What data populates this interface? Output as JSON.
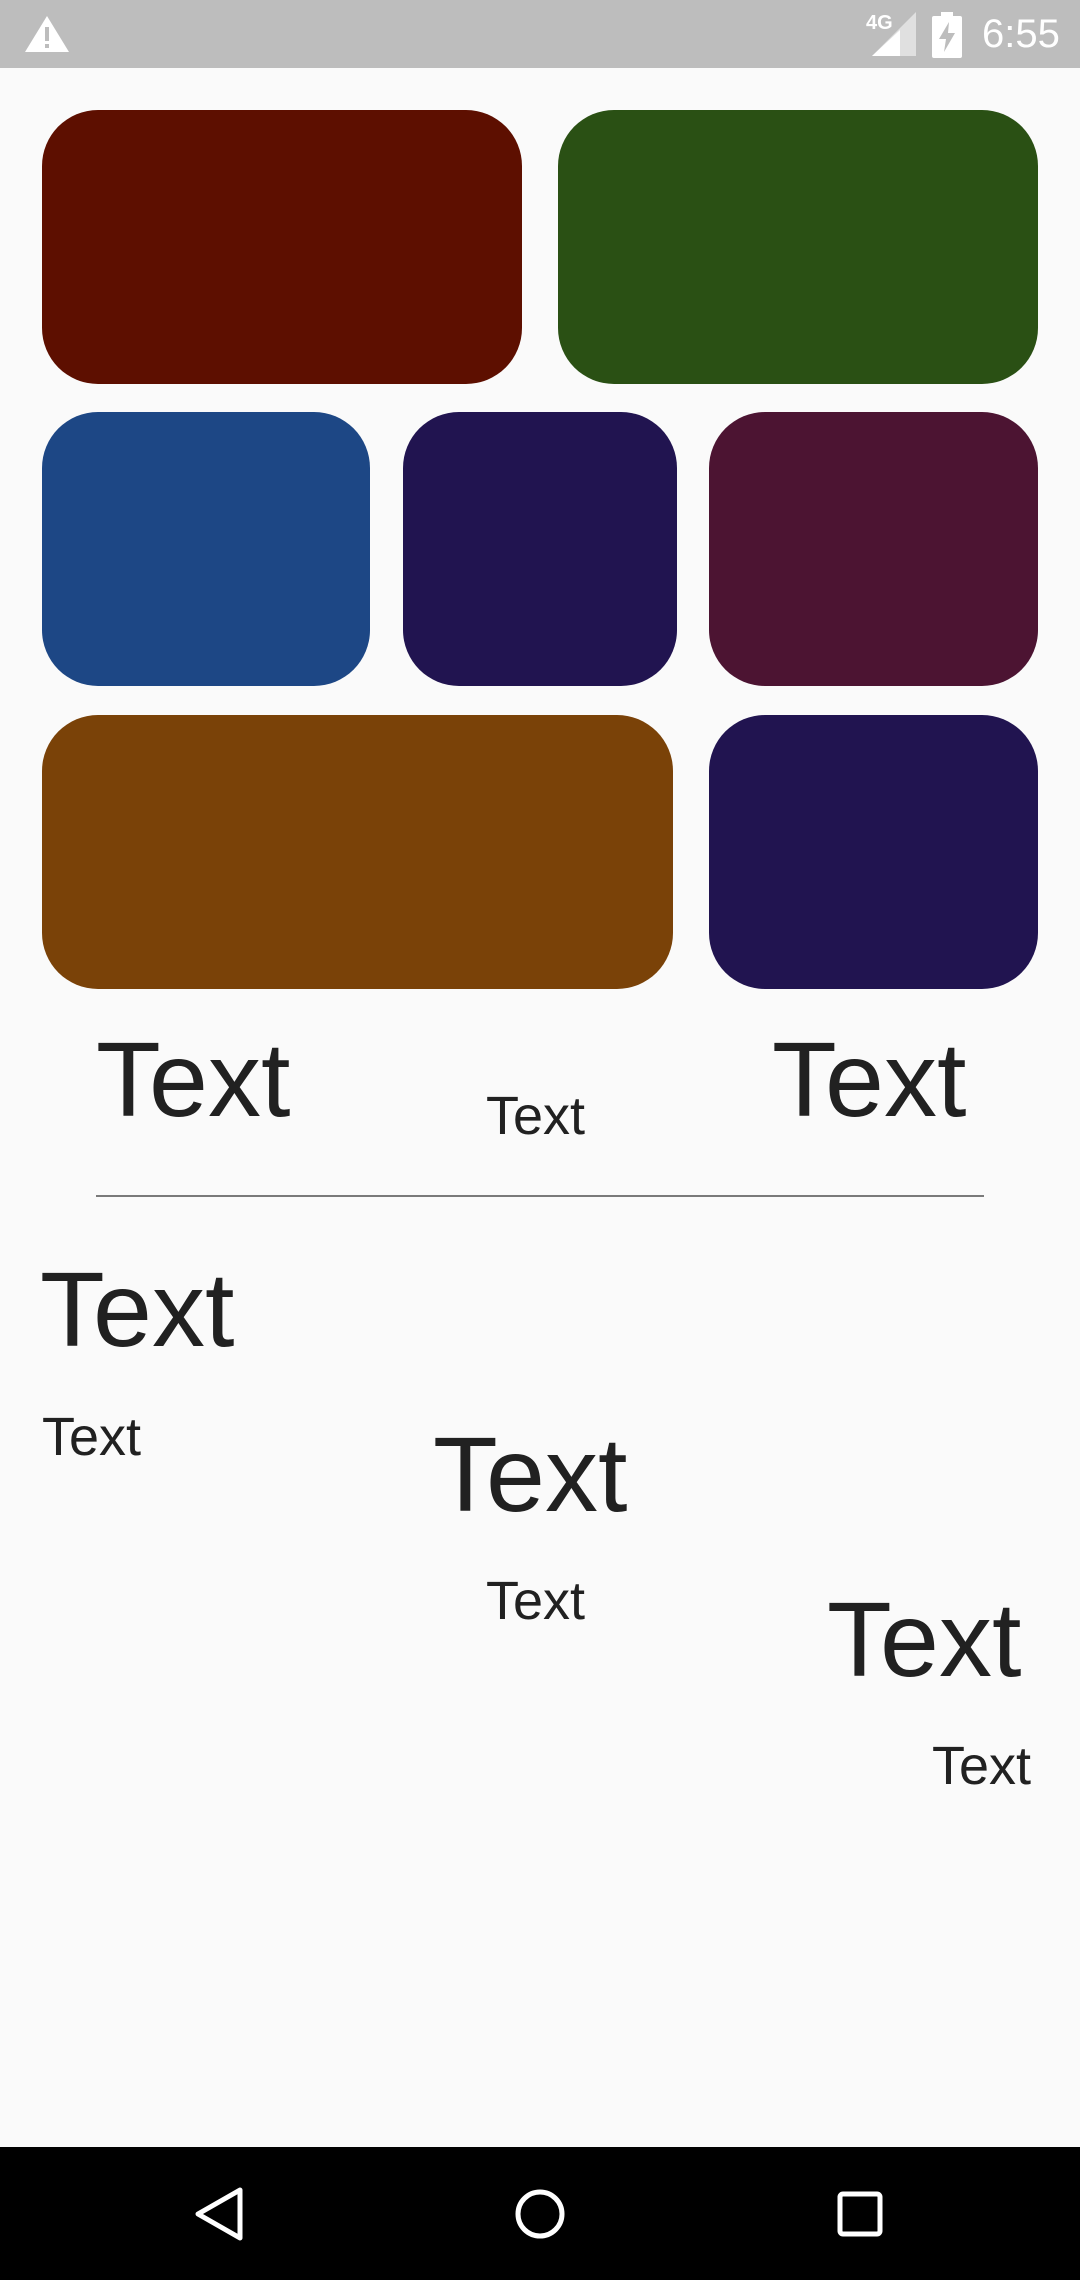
{
  "status_bar": {
    "network": "4G",
    "time": "6:55",
    "icons": [
      "warning-icon",
      "signal-icon",
      "battery-charging-icon"
    ]
  },
  "tiles": [
    {
      "name": "tile-red",
      "color": "#5d0f00"
    },
    {
      "name": "tile-green",
      "color": "#2a5014"
    },
    {
      "name": "tile-blue",
      "color": "#1d4785"
    },
    {
      "name": "tile-indigo-1",
      "color": "#211450"
    },
    {
      "name": "tile-plum",
      "color": "#4c1432"
    },
    {
      "name": "tile-orange",
      "color": "#7a4208"
    },
    {
      "name": "tile-indigo-2",
      "color": "#211450"
    }
  ],
  "labels": {
    "row1_left": "Text",
    "row1_center": "Text",
    "row1_right": "Text",
    "a_large": "Text",
    "a_small": "Text",
    "b_large": "Text",
    "b_small": "Text",
    "c_large": "Text",
    "c_small": "Text"
  },
  "nav": {
    "icons": [
      "back-icon",
      "home-icon",
      "recents-icon"
    ]
  }
}
